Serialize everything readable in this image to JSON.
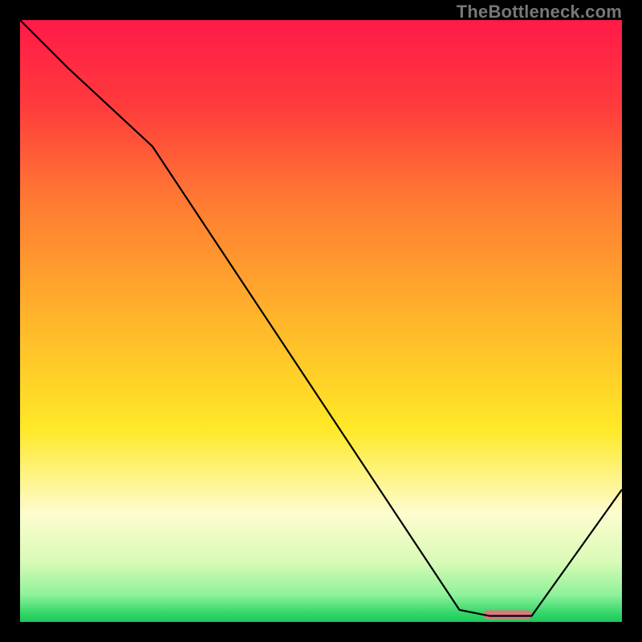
{
  "watermark": "TheBottleneck.com",
  "chart_data": {
    "type": "line",
    "title": "",
    "xlabel": "",
    "ylabel": "",
    "xlim": [
      0,
      100
    ],
    "ylim": [
      0,
      100
    ],
    "series": [
      {
        "name": "bottleneck-curve",
        "x": [
          0,
          8,
          22,
          73,
          78,
          85,
          100
        ],
        "y": [
          100,
          92,
          79,
          2,
          1,
          1,
          22
        ]
      }
    ],
    "marker": {
      "name": "optimal-range",
      "x_start": 77,
      "x_end": 85,
      "y": 1.2,
      "color": "#d87a7e"
    },
    "gradient_stops": [
      {
        "pct": 0.0,
        "color": "#ff1a48"
      },
      {
        "pct": 0.14,
        "color": "#ff3a3c"
      },
      {
        "pct": 0.3,
        "color": "#ff7a33"
      },
      {
        "pct": 0.5,
        "color": "#ffb62a"
      },
      {
        "pct": 0.68,
        "color": "#ffe927"
      },
      {
        "pct": 0.82,
        "color": "#fdfccf"
      },
      {
        "pct": 0.9,
        "color": "#d9fbb6"
      },
      {
        "pct": 0.955,
        "color": "#8ef29a"
      },
      {
        "pct": 0.985,
        "color": "#35d66a"
      },
      {
        "pct": 1.0,
        "color": "#18c95b"
      }
    ]
  }
}
